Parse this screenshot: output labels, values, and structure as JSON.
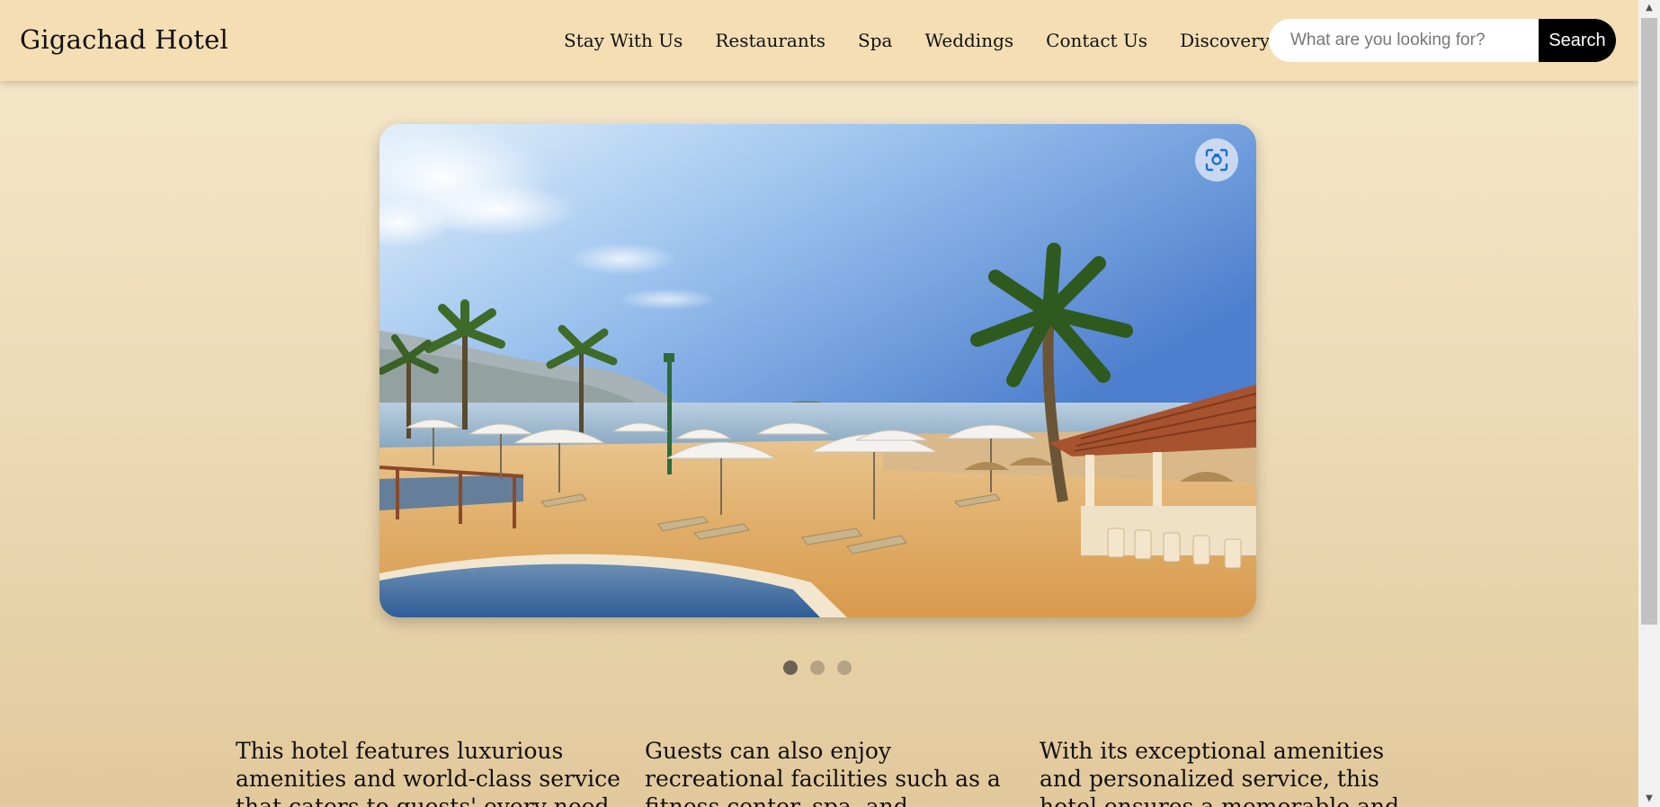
{
  "header": {
    "brand": "Gigachad Hotel",
    "nav": [
      {
        "label": "Stay With Us"
      },
      {
        "label": "Restaurants"
      },
      {
        "label": "Spa"
      },
      {
        "label": "Weddings"
      },
      {
        "label": "Contact Us"
      },
      {
        "label": "Discovery"
      }
    ],
    "search": {
      "placeholder": "What are you looking for?",
      "button_label": "Search"
    }
  },
  "carousel": {
    "image_description_icon": "beach-resort-image",
    "lens_icon": "visual-search-icon",
    "slide_count": 3,
    "active_slide": 1
  },
  "content": {
    "columns": [
      {
        "text": "This hotel features luxurious amenities and world-class service that caters to guests' every need"
      },
      {
        "text": "Guests can also enjoy recreational facilities such as a fitness center, spa, and"
      },
      {
        "text": "With its exceptional amenities and personalized service, this hotel ensures a memorable and"
      }
    ]
  },
  "colors": {
    "header_bg": "#f5deb3",
    "search_button_bg": "#000000",
    "active_dot": "#6b6253",
    "inactive_dot": "#b3a283"
  }
}
